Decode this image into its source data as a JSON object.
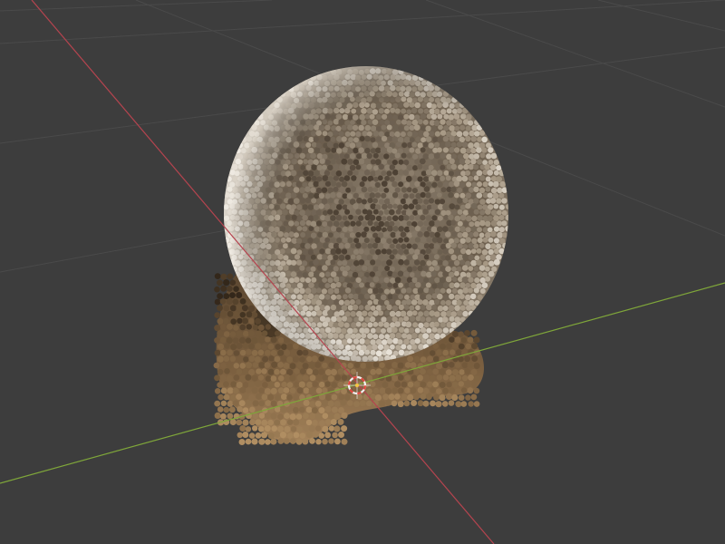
{
  "viewport": {
    "background_color": "#3d3d3d",
    "grid_color": "#4a4a4a",
    "x_axis_color": "#b5444f",
    "y_axis_color": "#7fa63a",
    "object": "particle-sphere-on-bone-base",
    "object_colors": {
      "sphere_light": "#e8e2d8",
      "sphere_mid": "#a89a86",
      "sphere_dark": "#4d4134",
      "base_light": "#b08e62",
      "base_mid": "#7a5f3f",
      "base_dark": "#33271a"
    },
    "cursor_icon": "3d-cursor-icon",
    "cursor_colors": {
      "ring_red": "#e0453c",
      "ring_white": "#f2f2f2",
      "center": "#f5c542"
    }
  }
}
